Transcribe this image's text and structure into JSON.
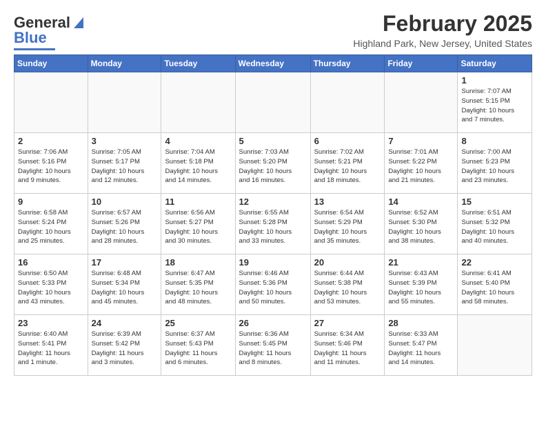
{
  "header": {
    "logo_general": "General",
    "logo_blue": "Blue",
    "title": "February 2025",
    "subtitle": "Highland Park, New Jersey, United States"
  },
  "days_of_week": [
    "Sunday",
    "Monday",
    "Tuesday",
    "Wednesday",
    "Thursday",
    "Friday",
    "Saturday"
  ],
  "weeks": [
    [
      {
        "day": "",
        "info": ""
      },
      {
        "day": "",
        "info": ""
      },
      {
        "day": "",
        "info": ""
      },
      {
        "day": "",
        "info": ""
      },
      {
        "day": "",
        "info": ""
      },
      {
        "day": "",
        "info": ""
      },
      {
        "day": "1",
        "info": "Sunrise: 7:07 AM\nSunset: 5:15 PM\nDaylight: 10 hours\nand 7 minutes."
      }
    ],
    [
      {
        "day": "2",
        "info": "Sunrise: 7:06 AM\nSunset: 5:16 PM\nDaylight: 10 hours\nand 9 minutes."
      },
      {
        "day": "3",
        "info": "Sunrise: 7:05 AM\nSunset: 5:17 PM\nDaylight: 10 hours\nand 12 minutes."
      },
      {
        "day": "4",
        "info": "Sunrise: 7:04 AM\nSunset: 5:18 PM\nDaylight: 10 hours\nand 14 minutes."
      },
      {
        "day": "5",
        "info": "Sunrise: 7:03 AM\nSunset: 5:20 PM\nDaylight: 10 hours\nand 16 minutes."
      },
      {
        "day": "6",
        "info": "Sunrise: 7:02 AM\nSunset: 5:21 PM\nDaylight: 10 hours\nand 18 minutes."
      },
      {
        "day": "7",
        "info": "Sunrise: 7:01 AM\nSunset: 5:22 PM\nDaylight: 10 hours\nand 21 minutes."
      },
      {
        "day": "8",
        "info": "Sunrise: 7:00 AM\nSunset: 5:23 PM\nDaylight: 10 hours\nand 23 minutes."
      }
    ],
    [
      {
        "day": "9",
        "info": "Sunrise: 6:58 AM\nSunset: 5:24 PM\nDaylight: 10 hours\nand 25 minutes."
      },
      {
        "day": "10",
        "info": "Sunrise: 6:57 AM\nSunset: 5:26 PM\nDaylight: 10 hours\nand 28 minutes."
      },
      {
        "day": "11",
        "info": "Sunrise: 6:56 AM\nSunset: 5:27 PM\nDaylight: 10 hours\nand 30 minutes."
      },
      {
        "day": "12",
        "info": "Sunrise: 6:55 AM\nSunset: 5:28 PM\nDaylight: 10 hours\nand 33 minutes."
      },
      {
        "day": "13",
        "info": "Sunrise: 6:54 AM\nSunset: 5:29 PM\nDaylight: 10 hours\nand 35 minutes."
      },
      {
        "day": "14",
        "info": "Sunrise: 6:52 AM\nSunset: 5:30 PM\nDaylight: 10 hours\nand 38 minutes."
      },
      {
        "day": "15",
        "info": "Sunrise: 6:51 AM\nSunset: 5:32 PM\nDaylight: 10 hours\nand 40 minutes."
      }
    ],
    [
      {
        "day": "16",
        "info": "Sunrise: 6:50 AM\nSunset: 5:33 PM\nDaylight: 10 hours\nand 43 minutes."
      },
      {
        "day": "17",
        "info": "Sunrise: 6:48 AM\nSunset: 5:34 PM\nDaylight: 10 hours\nand 45 minutes."
      },
      {
        "day": "18",
        "info": "Sunrise: 6:47 AM\nSunset: 5:35 PM\nDaylight: 10 hours\nand 48 minutes."
      },
      {
        "day": "19",
        "info": "Sunrise: 6:46 AM\nSunset: 5:36 PM\nDaylight: 10 hours\nand 50 minutes."
      },
      {
        "day": "20",
        "info": "Sunrise: 6:44 AM\nSunset: 5:38 PM\nDaylight: 10 hours\nand 53 minutes."
      },
      {
        "day": "21",
        "info": "Sunrise: 6:43 AM\nSunset: 5:39 PM\nDaylight: 10 hours\nand 55 minutes."
      },
      {
        "day": "22",
        "info": "Sunrise: 6:41 AM\nSunset: 5:40 PM\nDaylight: 10 hours\nand 58 minutes."
      }
    ],
    [
      {
        "day": "23",
        "info": "Sunrise: 6:40 AM\nSunset: 5:41 PM\nDaylight: 11 hours\nand 1 minute."
      },
      {
        "day": "24",
        "info": "Sunrise: 6:39 AM\nSunset: 5:42 PM\nDaylight: 11 hours\nand 3 minutes."
      },
      {
        "day": "25",
        "info": "Sunrise: 6:37 AM\nSunset: 5:43 PM\nDaylight: 11 hours\nand 6 minutes."
      },
      {
        "day": "26",
        "info": "Sunrise: 6:36 AM\nSunset: 5:45 PM\nDaylight: 11 hours\nand 8 minutes."
      },
      {
        "day": "27",
        "info": "Sunrise: 6:34 AM\nSunset: 5:46 PM\nDaylight: 11 hours\nand 11 minutes."
      },
      {
        "day": "28",
        "info": "Sunrise: 6:33 AM\nSunset: 5:47 PM\nDaylight: 11 hours\nand 14 minutes."
      },
      {
        "day": "",
        "info": ""
      }
    ]
  ]
}
